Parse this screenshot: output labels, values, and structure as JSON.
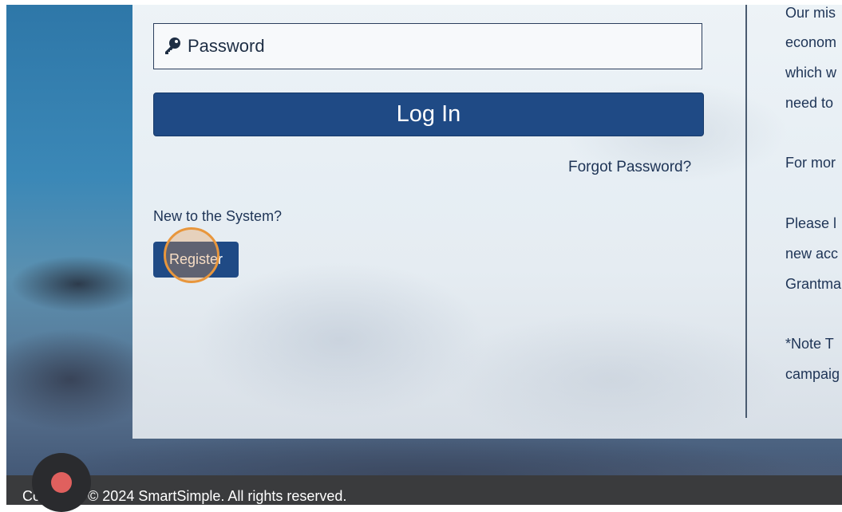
{
  "login": {
    "password_placeholder": "Password",
    "login_label": "Log In",
    "forgot_label": "Forgot Password?",
    "new_user_text": "New to the System?",
    "register_label": "Register"
  },
  "info_panel": {
    "lines": [
      "Our mis",
      "econom",
      "which w",
      "need to",
      "For mor",
      "Please l",
      "new acc",
      "Grantma",
      "*Note T",
      "campaig"
    ]
  },
  "footer": {
    "copyright": "Copyright © 2024 SmartSimple. All rights reserved."
  },
  "colors": {
    "primary_button": "#1f4a85",
    "click_highlight": "#e8963c",
    "record_dot": "#e0605e"
  },
  "icons": {
    "password_field": "key-icon",
    "recording": "record-icon"
  }
}
